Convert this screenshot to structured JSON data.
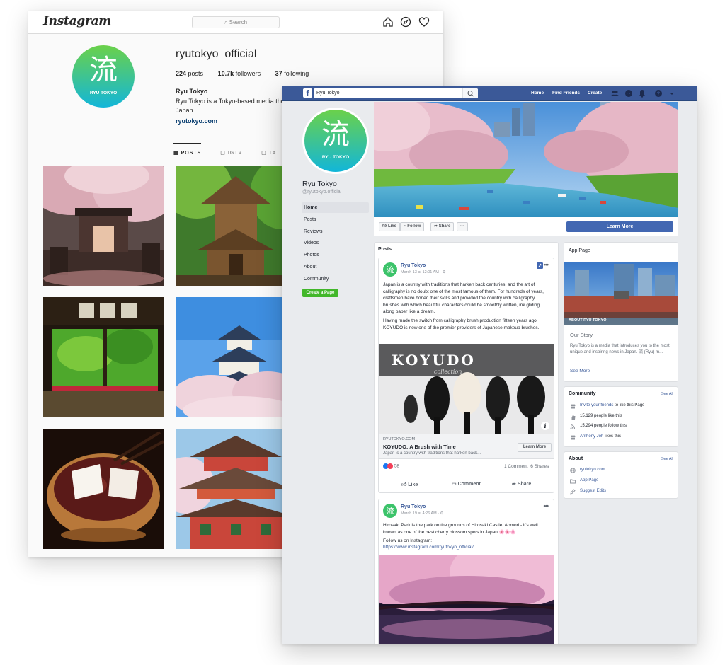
{
  "instagram": {
    "logo": "Instagram",
    "search_placeholder": "Search",
    "username": "ryutokyo_official",
    "stats": [
      {
        "value": "224",
        "label": "posts"
      },
      {
        "value": "10.7k",
        "label": "followers"
      },
      {
        "value": "37",
        "label": "following"
      }
    ],
    "bio_name": "Ryu Tokyo",
    "bio_text": "Ryu Tokyo is a Tokyo-based media the Japan.",
    "bio_link": "ryutokyo.com",
    "tabs": [
      "POSTS",
      "IGTV",
      "TA"
    ],
    "avatar_kanji": "流",
    "avatar_label": "RYU TOKYO"
  },
  "facebook": {
    "search_value": "Ryu Tokyo",
    "nav": [
      "Home",
      "Find Friends",
      "Create"
    ],
    "page_name": "Ryu Tokyo",
    "page_handle": "@ryutokyo.official",
    "avatar_kanji": "流",
    "avatar_label": "RYU TOKYO",
    "sidebar": [
      "Home",
      "Posts",
      "Reviews",
      "Videos",
      "Photos",
      "About",
      "Community"
    ],
    "create_page": "Create a Page",
    "actions": {
      "like": "Like",
      "follow": "Follow",
      "share": "Share",
      "more": "···",
      "learn_more": "Learn More"
    },
    "posts_heading": "Posts",
    "post1": {
      "author": "Ryu Tokyo",
      "time": "March 13 at 12:01 AM · ⚙",
      "para1": "Japan is a country with traditions that harken back centuries, and the art of calligraphy is no doubt one of the most famous of them. For hundreds of years, craftsmen have honed their skills and provided the country with calligraphy brushes with which beautiful characters could be smoothly written, ink gliding along paper like a dream.",
      "para2": "Having made the switch from calligraphy brush production fifteen years ago, KOYUDO is now one of the premier providers of Japanese makeup brushes.",
      "image_brand": "KOYUDO",
      "image_sub": "collection",
      "link_domain": "RYUTOKYO.COM",
      "link_title": "KOYUDO: A Brush with Time",
      "link_desc": "Japan is a country with traditions that harken back...",
      "link_button": "Learn More",
      "reactions": "58",
      "comments": "1 Comment",
      "shares": "6 Shares",
      "btn_like": "Like",
      "btn_comment": "Comment",
      "btn_share": "Share"
    },
    "post2": {
      "author": "Ryu Tokyo",
      "time": "March 19 at 4:26 AM · ⚙",
      "para1": "Hirosaki Park is the park on the grounds of Hirosaki Castle, Aomori - it's well known as one of the best cherry blossom spots in Japan 🌸🌸🌸",
      "para2": "Follow us on Instagram:",
      "link": "https://www.instagram.com/ryutokyo_official/"
    },
    "app_page": {
      "title": "App Page",
      "image_caption": "ABOUT RYU TOKYO",
      "story_title": "Our Story",
      "story_text": "Ryu Tokyo is a media that introduces you to the most unique and inspiring news in Japan. 流 (Ryu) m...",
      "see_more": "See More"
    },
    "community": {
      "title": "Community",
      "see_all": "See All",
      "invite_link": "Invite your friends",
      "invite_rest": " to like this Page",
      "likes": "15,129 people like this",
      "follows": "15,294 people follow this",
      "friend_link": "Anthony Joh",
      "friend_rest": " likes this"
    },
    "about": {
      "title": "About",
      "see_all": "See All",
      "website": "ryutokyo.com",
      "app_page": "App Page",
      "suggest": "Suggest Edits"
    }
  }
}
